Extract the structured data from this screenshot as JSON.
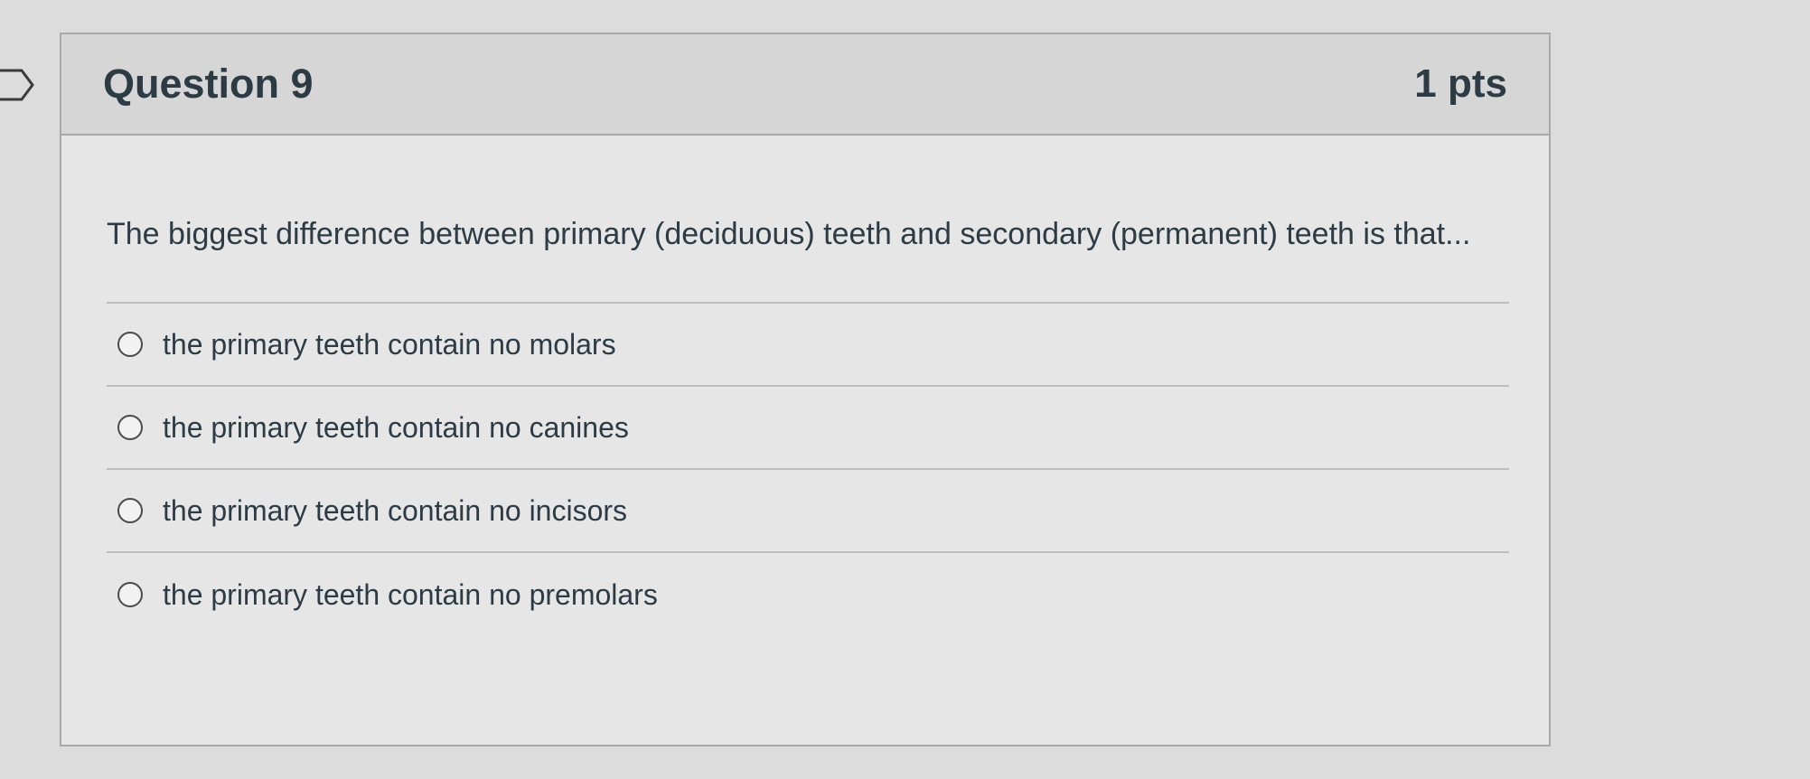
{
  "question": {
    "title": "Question 9",
    "points": "1 pts",
    "text": "The biggest difference between primary (deciduous) teeth and secondary (permanent) teeth is that..."
  },
  "answers": [
    {
      "label": "the primary teeth contain no molars",
      "selected": false
    },
    {
      "label": "the primary teeth contain no canines",
      "selected": false
    },
    {
      "label": "the primary teeth contain no incisors",
      "selected": false
    },
    {
      "label": "the primary teeth contain no premolars",
      "selected": false
    }
  ],
  "icons": {
    "flag": "flag-question-icon",
    "radio": "radio-unselected-icon"
  },
  "colors": {
    "text": "#2d3b45",
    "header_bg": "#d6d6d6",
    "card_bg": "#e6e6e6",
    "border": "#a9a9a9"
  }
}
